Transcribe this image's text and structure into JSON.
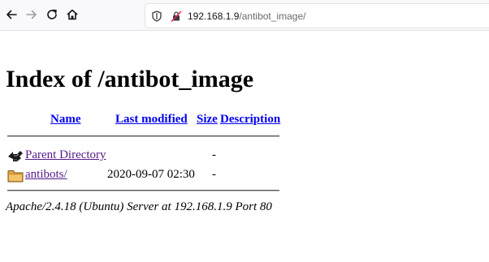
{
  "browser": {
    "url_host": "192.168.1.9",
    "url_path": "/antibot_image/"
  },
  "page": {
    "title": "Index of /antibot_image",
    "columns": {
      "name": "Name",
      "last_modified": "Last modified",
      "size": "Size",
      "description": "Description"
    },
    "rows": [
      {
        "name": "Parent Directory",
        "modified": "",
        "size": "-",
        "description": ""
      },
      {
        "name": "antibots/",
        "modified": "2020-09-07 02:30",
        "size": "-",
        "description": ""
      }
    ],
    "address": "Apache/2.4.18 (Ubuntu) Server at 192.168.1.9 Port 80"
  },
  "colors": {
    "link": "#0000ee",
    "visited_link": "#551a8b",
    "folder": "#e8a640"
  },
  "icons": [
    "back-icon",
    "forward-icon",
    "reload-icon",
    "home-icon",
    "shield-icon",
    "insecure-lock-icon",
    "back-arrow-icon",
    "folder-icon"
  ]
}
